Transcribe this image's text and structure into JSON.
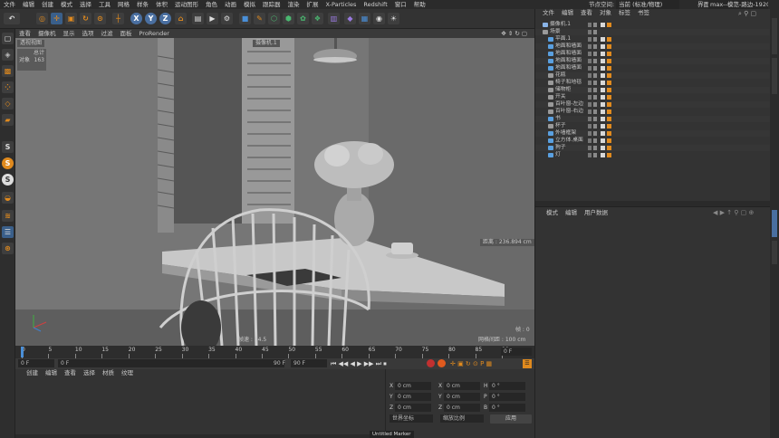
{
  "menubar": {
    "items": [
      "文件",
      "编辑",
      "创建",
      "模式",
      "选择",
      "工具",
      "网格",
      "样条",
      "体积",
      "运动图形",
      "角色",
      "动画",
      "模拟",
      "跟踪器",
      "渲染",
      "扩展",
      "X-Particles",
      "Redshift",
      "窗口",
      "帮助"
    ],
    "node_space_label": "节点空间:",
    "node_space_value": "当前 (标准/物理)",
    "layout_label": "界面:",
    "layout_value": "max--模范-路边-1920 (用户)"
  },
  "toolbar": {
    "x_label": "X",
    "y_label": "Y",
    "z_label": "Z"
  },
  "viewport": {
    "menu": [
      "查看",
      "摄像机",
      "显示",
      "选项",
      "过滤",
      "面板",
      "ProRender"
    ],
    "view_name": "透视视图",
    "camera_label": "摄像机.1",
    "stats_total_label": "总计",
    "stats_objects_label": "对象",
    "stats_objects_value": "163",
    "distance_text": "距离 : 236.894 cm",
    "frame_text": "帧 : 0",
    "fps_text": "帧速 : 54.5",
    "grid_text": "网格间距 : 100 cm"
  },
  "timeline": {
    "ticks": [
      "0",
      "5",
      "10",
      "15",
      "20",
      "25",
      "30",
      "35",
      "40",
      "45",
      "50",
      "55",
      "60",
      "65",
      "70",
      "75",
      "80",
      "85",
      "90"
    ],
    "current_frame": "0 F"
  },
  "transport": {
    "start": "0 F",
    "current": "0 F",
    "end": "90 F",
    "end2": "90 F"
  },
  "materials": {
    "menu": [
      "创建",
      "编辑",
      "查看",
      "选择",
      "材质",
      "纹理"
    ]
  },
  "coords": {
    "rows": [
      {
        "a": "X",
        "av": "0 cm",
        "b": "X",
        "bv": "0 cm",
        "c": "H",
        "cv": "0 °"
      },
      {
        "a": "Y",
        "av": "0 cm",
        "b": "Y",
        "bv": "0 cm",
        "c": "P",
        "cv": "0 °"
      },
      {
        "a": "Z",
        "av": "0 cm",
        "b": "Z",
        "bv": "0 cm",
        "c": "B",
        "cv": "0 °"
      }
    ],
    "mode_value": "世界坐标",
    "scale_value": "缩放比例",
    "apply_label": "应用"
  },
  "object_manager": {
    "menu": [
      "文件",
      "编辑",
      "查看",
      "对象",
      "标签",
      "书签"
    ],
    "objects": [
      {
        "name": "摄像机.1",
        "depth": 0,
        "color": "#8ab4e8"
      },
      {
        "name": "场景",
        "depth": 0,
        "color": "#9a9a9a"
      },
      {
        "name": "平面.1",
        "depth": 1,
        "color": "#5aa0e0"
      },
      {
        "name": "地面和墙面",
        "depth": 1,
        "color": "#5aa0e0"
      },
      {
        "name": "地面和墙面",
        "depth": 1,
        "color": "#5aa0e0"
      },
      {
        "name": "地面和墙面",
        "depth": 1,
        "color": "#5aa0e0"
      },
      {
        "name": "地面和墙面",
        "depth": 1,
        "color": "#5aa0e0"
      },
      {
        "name": "花瓶",
        "depth": 1,
        "color": "#9a9a9a"
      },
      {
        "name": "椅子和地毯",
        "depth": 1,
        "color": "#9a9a9a"
      },
      {
        "name": "储物柜",
        "depth": 1,
        "color": "#9a9a9a"
      },
      {
        "name": "开关",
        "depth": 1,
        "color": "#9a9a9a"
      },
      {
        "name": "百叶窗-左边",
        "depth": 1,
        "color": "#9a9a9a"
      },
      {
        "name": "百叶窗-右边",
        "depth": 1,
        "color": "#9a9a9a"
      },
      {
        "name": "书",
        "depth": 1,
        "color": "#5aa0e0"
      },
      {
        "name": "杯子",
        "depth": 1,
        "color": "#9a9a9a"
      },
      {
        "name": "外墙框架",
        "depth": 1,
        "color": "#5aa0e0"
      },
      {
        "name": "立方体.桌面",
        "depth": 1,
        "color": "#5aa0e0"
      },
      {
        "name": "狗子",
        "depth": 1,
        "color": "#5aa0e0"
      },
      {
        "name": "灯",
        "depth": 1,
        "color": "#5aa0e0"
      }
    ]
  },
  "attribute_manager": {
    "menu": [
      "模式",
      "编辑",
      "用户数据"
    ]
  },
  "status": {
    "marker_text": "Untitled Marker"
  },
  "colors": {
    "accent_orange": "#e08a1e",
    "accent_blue": "#4a8fd8",
    "panel": "#333333",
    "viewport": "#6e6e6e"
  }
}
